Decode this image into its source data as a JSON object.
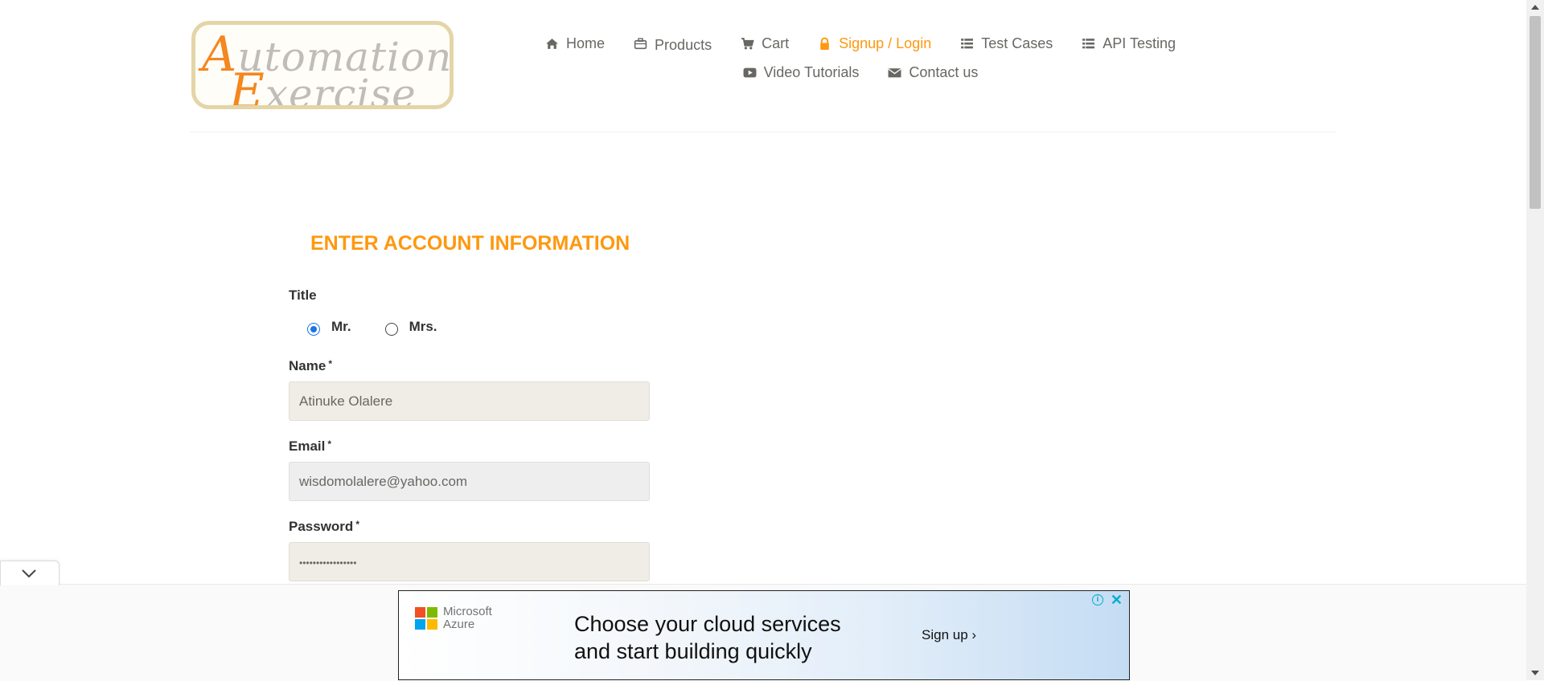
{
  "logo": {
    "line1_first": "A",
    "line1_rest": "utomation",
    "line2_first": "E",
    "line2_rest": "xercise"
  },
  "nav": {
    "items": [
      {
        "label": "Home",
        "icon": "home-icon"
      },
      {
        "label": "Products",
        "icon": "briefcase-icon"
      },
      {
        "label": "Cart",
        "icon": "cart-icon"
      },
      {
        "label": "Signup / Login",
        "icon": "lock-icon",
        "active": true
      },
      {
        "label": "Test Cases",
        "icon": "list-icon"
      },
      {
        "label": "API Testing",
        "icon": "list-icon"
      },
      {
        "label": "Video Tutorials",
        "icon": "youtube-icon"
      },
      {
        "label": "Contact us",
        "icon": "envelope-icon"
      }
    ],
    "active_color": "#fe980f"
  },
  "form": {
    "heading": "ENTER ACCOUNT INFORMATION",
    "title_label": "Title",
    "title_options": [
      "Mr.",
      "Mrs."
    ],
    "title_selected": "Mr.",
    "name_label": "Name",
    "name_value": "Atinuke Olalere",
    "email_label": "Email",
    "email_value": "wisdomolalere@yahoo.com",
    "password_label": "Password",
    "password_value": "•••••••••••••••••",
    "required_mark": "*"
  },
  "ad": {
    "brand_line1": "Microsoft",
    "brand_line2": "Azure",
    "headline_line1": "Choose your cloud services",
    "headline_line2": "and start building quickly",
    "cta": "Sign up ›",
    "info": "i",
    "close": "✕"
  }
}
